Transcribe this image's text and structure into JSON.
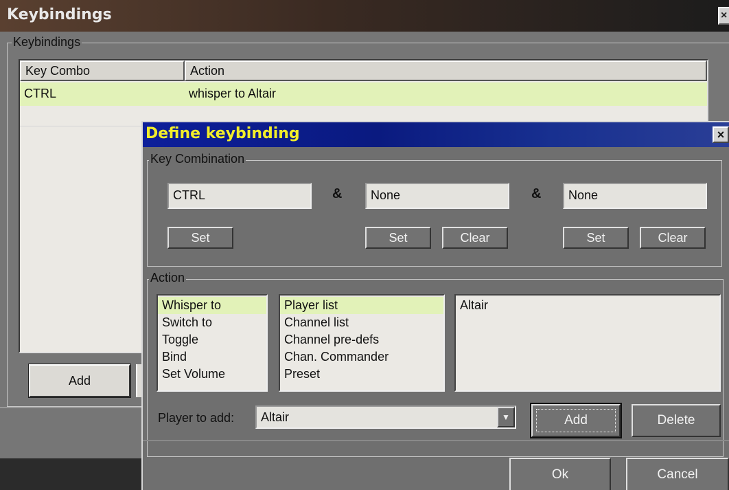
{
  "main_window": {
    "title": "Keybindings",
    "group_label": "Keybindings",
    "columns": [
      "Key Combo",
      "Action"
    ],
    "rows": [
      {
        "key_combo": "CTRL",
        "action": "whisper to Altair"
      }
    ],
    "add_label": "Add",
    "close_glyph": "×"
  },
  "dialog": {
    "title": "Define keybinding",
    "close_glyph": "×",
    "key_combination": {
      "label": "Key Combination",
      "keys": [
        "CTRL",
        "None",
        "None"
      ],
      "amp": "&",
      "set_label": "Set",
      "clear_label": "Clear"
    },
    "action": {
      "label": "Action",
      "types": [
        "Whisper to",
        "Switch to",
        "Toggle",
        "Bind",
        "Set Volume"
      ],
      "selected_type": "Whisper to",
      "sources": [
        "Player list",
        "Channel list",
        "Channel pre-defs",
        "Chan. Commander",
        "Preset"
      ],
      "selected_source": "Player list",
      "items": [
        "Altair"
      ],
      "player_to_add_label": "Player to add:",
      "player_to_add_value": "Altair",
      "add_label": "Add",
      "delete_label": "Delete"
    },
    "ok_label": "Ok",
    "cancel_label": "Cancel"
  },
  "colors": {
    "selection": "#e2f2b8",
    "dialog_title_text": "#f2ee2a",
    "dialog_title_bg": "#0d1f9a"
  }
}
